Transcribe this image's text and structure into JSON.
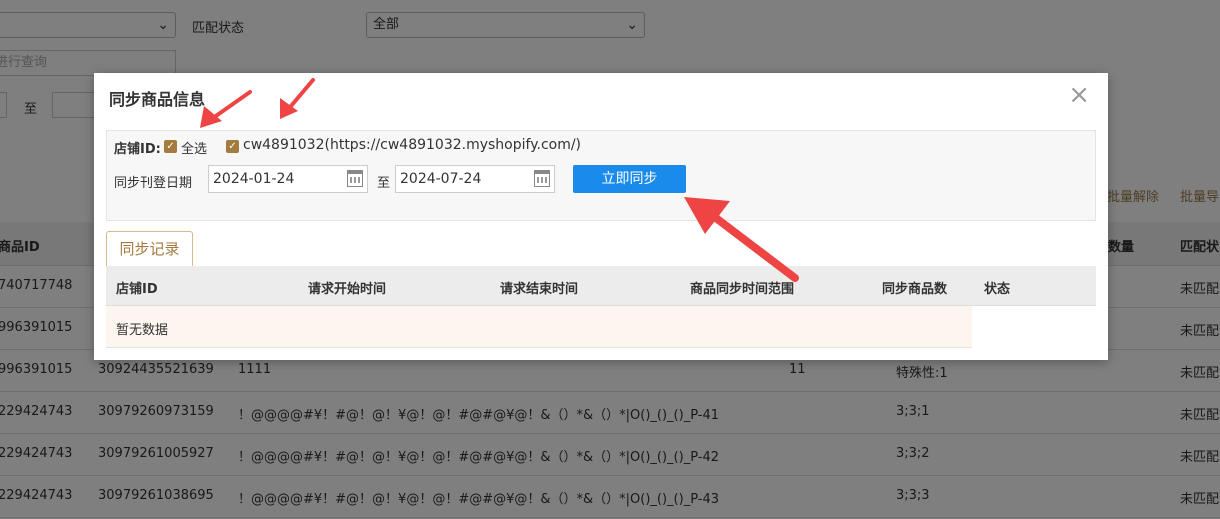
{
  "background": {
    "match_status_label": "匹配状态",
    "match_status_value": "全部",
    "search_placeholder": "进行查询",
    "date_to_label": "至",
    "batch_unmatch": "批量解除",
    "batch_export": "批量导",
    "columns": [
      "商品ID",
      "数量",
      "匹配状"
    ],
    "rows": [
      {
        "c1": "740717748",
        "c2": "",
        "c3": "",
        "c4": "",
        "c5": "",
        "c6": "未匹配"
      },
      {
        "c1": "996391015",
        "c2": "",
        "c3": "",
        "c4": "",
        "c5": "",
        "c6": "未匹配"
      },
      {
        "c1": "996391015",
        "c2": "30924435521639",
        "c3": "1111",
        "c4": "11",
        "c5": "特殊性:1",
        "c6": "未匹配"
      },
      {
        "c1": "229424743",
        "c2": "30979260973159",
        "c3": "！@@@@#¥！#@！@！¥@！@！#@#@¥@！&（）*&（）*|O()_()_()_P-41",
        "c4": "",
        "c5": "3;3;1",
        "c6": "未匹配"
      },
      {
        "c1": "229424743",
        "c2": "30979261005927",
        "c3": "！@@@@#¥！#@！@！¥@！@！#@#@¥@！&（）*&（）*|O()_()_()_P-42",
        "c4": "",
        "c5": "3;3;2",
        "c6": "未匹配"
      },
      {
        "c1": "229424743",
        "c2": "30979261038695",
        "c3": "！@@@@#¥！#@！@！¥@！@！#@#@¥@！&（）*&（）*|O()_()_()_P-43",
        "c4": "",
        "c5": "3;3;3",
        "c6": "未匹配"
      }
    ]
  },
  "modal": {
    "title": "同步商品信息",
    "close": "×",
    "store_label": "店铺ID:",
    "select_all": "全选",
    "store_option": "cw4891032(https://cw4891032.myshopify.com/)",
    "date_label": "同步刊登日期",
    "start_date": "2024-01-24",
    "to_label": "至",
    "end_date": "2024-07-24",
    "sync_button": "立即同步",
    "tab_label": "同步记录",
    "record_columns": [
      "店铺ID",
      "请求开始时间",
      "请求结束时间",
      "商品同步时间范围",
      "同步商品数",
      "状态"
    ],
    "empty_text": "暂无数据"
  },
  "colors": {
    "accent": "#a57a3f",
    "primary_button": "#1a8bea",
    "arrow": "#ee4444"
  }
}
